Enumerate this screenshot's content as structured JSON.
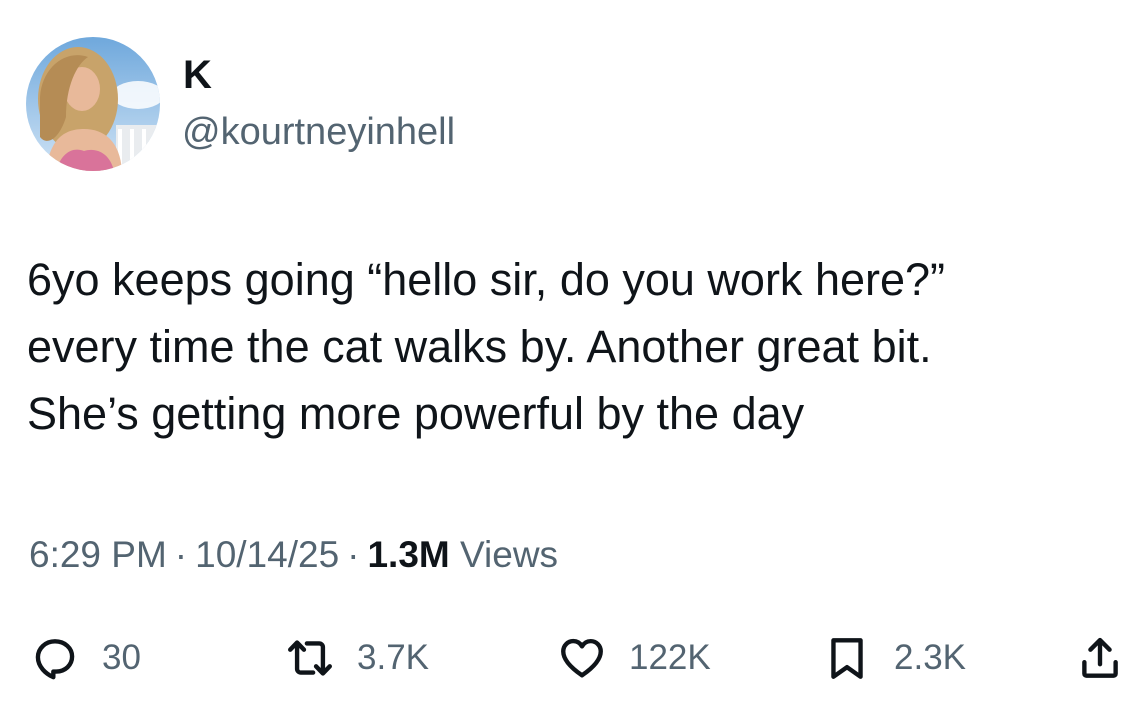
{
  "author": {
    "display_name": "K",
    "handle": "@kourtneyinhell"
  },
  "tweet": {
    "text": "6yo keeps going “hello sir, do you work here?”\nevery time the cat walks by. Another great bit.\nShe’s getting more powerful by the day"
  },
  "meta": {
    "time": "6:29 PM",
    "separator": "·",
    "date": "10/14/25",
    "views_count": "1.3M",
    "views_label": "Views"
  },
  "actions": {
    "reply": {
      "icon": "reply-icon",
      "count": "30"
    },
    "retweet": {
      "icon": "retweet-icon",
      "count": "3.7K"
    },
    "like": {
      "icon": "heart-icon",
      "count": "122K"
    },
    "bookmark": {
      "icon": "bookmark-icon",
      "count": "2.3K"
    },
    "share": {
      "icon": "share-icon"
    }
  },
  "colors": {
    "text_primary": "#0f1419",
    "text_secondary": "#536471",
    "background": "#ffffff"
  }
}
